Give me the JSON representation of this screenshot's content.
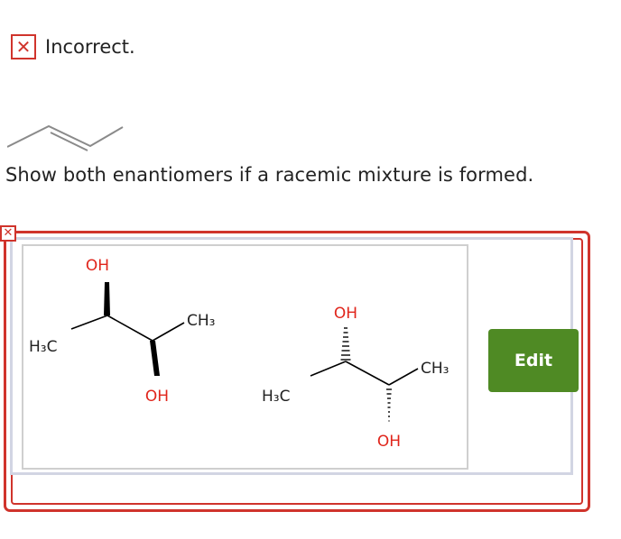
{
  "feedback": {
    "status_icon": "close-icon",
    "status_text": "Incorrect.",
    "status_color": "#d0342c"
  },
  "question": {
    "reactant": "trans-2-butene",
    "text": "Show both enantiomers if a racemic mixture is formed."
  },
  "answer": {
    "molecule_1": {
      "oh_top": "OH",
      "h3c": "H₃C",
      "ch3": "CH₃",
      "oh_bottom": "OH"
    },
    "molecule_2": {
      "oh_top": "OH",
      "h3c": "H₃C",
      "ch3": "CH₃",
      "oh_bottom": "OH"
    },
    "edit_label": "Edit",
    "edit_color": "#4f8a24",
    "marker_icon": "close-icon"
  }
}
